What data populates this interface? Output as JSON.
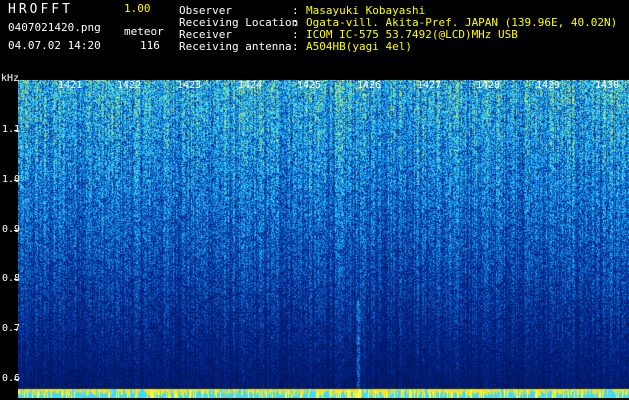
{
  "header": {
    "app_name": "HROFFT",
    "version": "1.00",
    "filename": "0407021420.png",
    "datetime": "04.07.02 14:20",
    "mode_label": "meteor",
    "count": "116"
  },
  "info": [
    {
      "label": "Observer",
      "sep": ":",
      "value": "Masayuki Kobayashi"
    },
    {
      "label": "Receiving Location",
      "sep": ":",
      "value": "Ogata-vill. Akita-Pref. JAPAN (139.96E, 40.02N)"
    },
    {
      "label": "Receiver",
      "sep": ":",
      "value": "ICOM IC-575 53.7492(@LCD)MHz USB"
    },
    {
      "label": "Receiving antenna",
      "sep": ":",
      "value": "A504HB(yagi 4el)"
    }
  ],
  "y_axis": {
    "unit": "kHz",
    "ticks": [
      "1.1",
      "1.0",
      "0.9",
      "0.8",
      "0.7",
      "0.6"
    ]
  },
  "x_axis": {
    "ticks": [
      "1421",
      "1422",
      "1423",
      "1424",
      "1425",
      "1426",
      "1427",
      "1428",
      "1429",
      "1430"
    ]
  },
  "colors": {
    "background": "#000000",
    "text": "#ffffff",
    "highlight": "#ffff00",
    "spectrum_low": "#001a5e",
    "spectrum_mid": "#1a4fd6",
    "spectrum_high": "#2ec8ff",
    "spectrum_peak": "#ffff40"
  }
}
